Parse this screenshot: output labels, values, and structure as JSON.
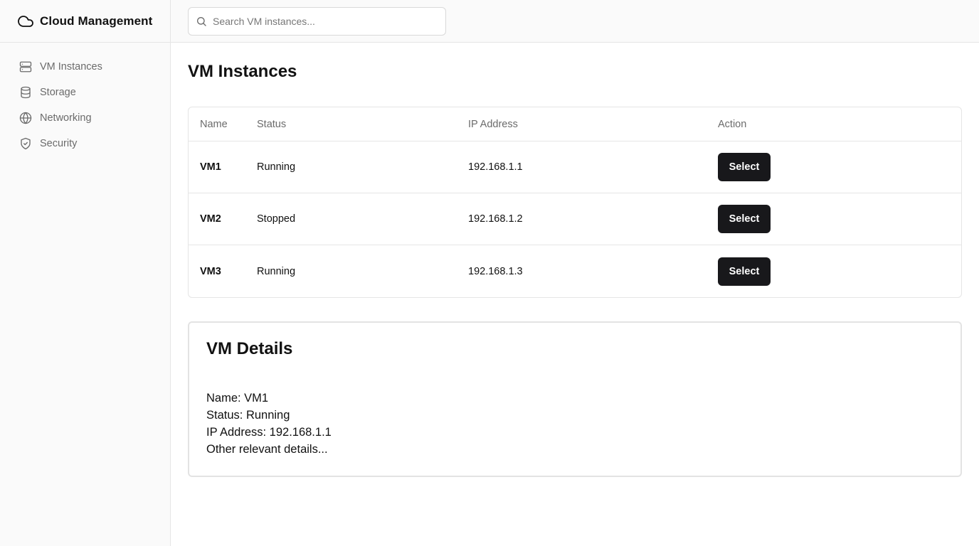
{
  "app": {
    "title": "Cloud Management"
  },
  "sidebar": {
    "items": [
      {
        "label": "VM Instances",
        "icon": "server-icon"
      },
      {
        "label": "Storage",
        "icon": "database-icon"
      },
      {
        "label": "Networking",
        "icon": "globe-icon"
      },
      {
        "label": "Security",
        "icon": "shield-icon"
      }
    ]
  },
  "search": {
    "placeholder": "Search VM instances...",
    "value": ""
  },
  "main": {
    "title": "VM Instances",
    "table": {
      "columns": [
        "Name",
        "Status",
        "IP Address",
        "Action"
      ],
      "rows": [
        {
          "name": "VM1",
          "status": "Running",
          "ip": "192.168.1.1",
          "action": "Select"
        },
        {
          "name": "VM2",
          "status": "Stopped",
          "ip": "192.168.1.2",
          "action": "Select"
        },
        {
          "name": "VM3",
          "status": "Running",
          "ip": "192.168.1.3",
          "action": "Select"
        }
      ]
    },
    "details": {
      "title": "VM Details",
      "lines": [
        "Name: VM1",
        "Status: Running",
        "IP Address: 192.168.1.1",
        "Other relevant details..."
      ]
    }
  },
  "colors": {
    "button_bg": "#18181b",
    "sidebar_bg": "#fafafa",
    "border": "#e5e5e5",
    "muted_text": "#6b6b6b"
  }
}
